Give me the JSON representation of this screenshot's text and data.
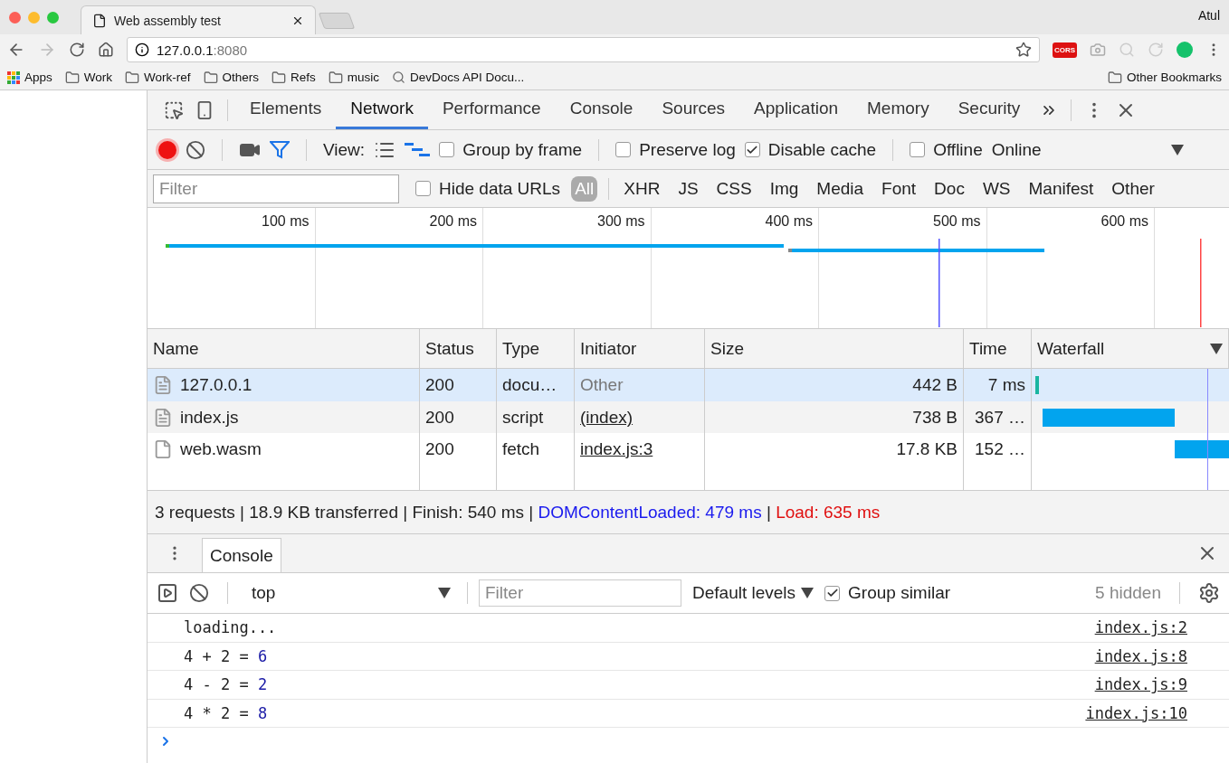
{
  "browser": {
    "tab_title": "Web assembly test",
    "profile_name": "Atul",
    "url_host": "127.0.0.1",
    "url_port": ":8080",
    "extension_badge": "CORS",
    "bookmarks": [
      {
        "label": "Apps",
        "kind": "apps"
      },
      {
        "label": "Work",
        "kind": "folder"
      },
      {
        "label": "Work-ref",
        "kind": "folder"
      },
      {
        "label": "Others",
        "kind": "folder"
      },
      {
        "label": "Refs",
        "kind": "folder"
      },
      {
        "label": "music",
        "kind": "folder"
      },
      {
        "label": "DevDocs API Docu...",
        "kind": "page"
      }
    ],
    "other_bookmarks": "Other Bookmarks"
  },
  "devtools": {
    "panel_tabs": [
      {
        "label": "Elements",
        "selected": false
      },
      {
        "label": "Network",
        "selected": true
      },
      {
        "label": "Performance",
        "selected": false
      },
      {
        "label": "Console",
        "selected": false
      },
      {
        "label": "Sources",
        "selected": false
      },
      {
        "label": "Application",
        "selected": false
      },
      {
        "label": "Memory",
        "selected": false
      },
      {
        "label": "Security",
        "selected": false
      }
    ],
    "toolbar": {
      "recording": true,
      "view_label": "View:",
      "filter_active": true,
      "options": [
        {
          "label": "Group by frame",
          "checked": false
        },
        {
          "label": "Preserve log",
          "checked": false
        },
        {
          "label": "Disable cache",
          "checked": true
        },
        {
          "label": "Offline",
          "checked": false
        }
      ],
      "throttling": "Online"
    },
    "filter_bar": {
      "placeholder": "Filter",
      "hide_data_urls": {
        "label": "Hide data URLs",
        "checked": false
      },
      "types": [
        {
          "label": "All",
          "selected": true
        },
        {
          "label": "XHR",
          "selected": false
        },
        {
          "label": "JS",
          "selected": false
        },
        {
          "label": "CSS",
          "selected": false
        },
        {
          "label": "Img",
          "selected": false
        },
        {
          "label": "Media",
          "selected": false
        },
        {
          "label": "Font",
          "selected": false
        },
        {
          "label": "Doc",
          "selected": false
        },
        {
          "label": "WS",
          "selected": false
        },
        {
          "label": "Manifest",
          "selected": false
        },
        {
          "label": "Other",
          "selected": false
        }
      ]
    },
    "overview": {
      "ticks": [
        "100 ms",
        "200 ms",
        "300 ms",
        "400 ms",
        "500 ms",
        "600 ms"
      ]
    },
    "table": {
      "columns": [
        "Name",
        "Status",
        "Type",
        "Initiator",
        "Size",
        "Time",
        "Waterfall"
      ],
      "rows": [
        {
          "name": "127.0.0.1",
          "status": "200",
          "type": "docu…",
          "initiator": "Other",
          "initiator_link": false,
          "size": "442 B",
          "time": "7 ms",
          "selected": true
        },
        {
          "name": "index.js",
          "status": "200",
          "type": "script",
          "initiator": "(index)",
          "initiator_link": true,
          "size": "738 B",
          "time": "367 …",
          "selected": false
        },
        {
          "name": "web.wasm",
          "status": "200",
          "type": "fetch",
          "initiator": "index.js:3",
          "initiator_link": true,
          "size": "17.8 KB",
          "time": "152 …",
          "selected": false
        }
      ]
    },
    "summary": [
      {
        "text": "3 requests | 18.9 KB transferred | Finish: 540 ms | ",
        "kind": "plain"
      },
      {
        "text": "DOMContentLoaded: 479 ms",
        "kind": "dom"
      },
      {
        "text": " | ",
        "kind": "plain"
      },
      {
        "text": "Load: 635 ms",
        "kind": "load"
      }
    ],
    "drawer": {
      "tabs": [
        {
          "label": "Console",
          "selected": true
        }
      ],
      "context": "top",
      "filter_placeholder": "Filter",
      "levels": "Default levels",
      "group_similar": {
        "label": "Group similar",
        "checked": true
      },
      "hidden": "5 hidden",
      "messages": [
        {
          "text": "loading...",
          "source": "index.js:2"
        },
        {
          "text": "4 + 2 = ",
          "result": "6",
          "source": "index.js:8"
        },
        {
          "text": "4 - 2 = ",
          "result": "2",
          "source": "index.js:9"
        },
        {
          "text": "4 * 2 = ",
          "result": "8",
          "source": "index.js:10"
        }
      ]
    }
  }
}
